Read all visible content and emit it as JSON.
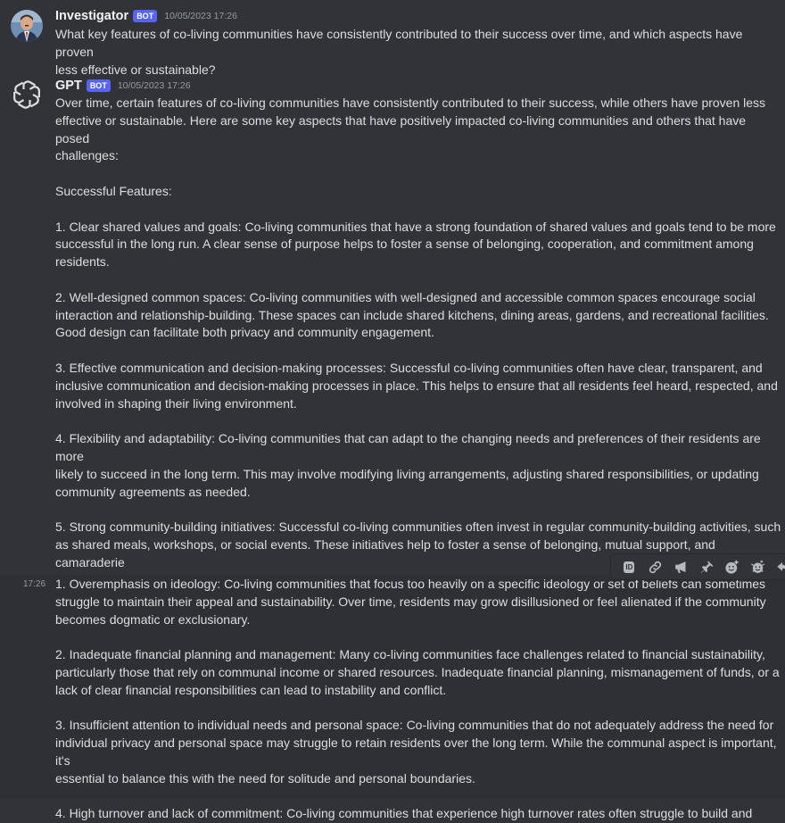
{
  "messages": [
    {
      "author": "Investigator",
      "badge": "BOT",
      "timestamp": "10/05/2023 17:26",
      "text": "What key features of co-living communities have consistently contributed to their success over time, and which aspects have proven\nless effective or sustainable?"
    },
    {
      "author": "GPT",
      "badge": "BOT",
      "timestamp": "10/05/2023 17:26",
      "text": "Over time, certain features of co-living communities have consistently contributed to their success, while others have proven less\neffective or sustainable. Here are some key aspects that have positively impacted co-living communities and others that have posed\nchallenges:\n\nSuccessful Features:\n\n1. Clear shared values and goals: Co-living communities that have a strong foundation of shared values and goals tend to be more\nsuccessful in the long run. A clear sense of purpose helps to foster a sense of belonging, cooperation, and commitment among\nresidents.\n\n2. Well-designed common spaces: Co-living communities with well-designed and accessible common spaces encourage social\ninteraction and relationship-building. These spaces can include shared kitchens, dining areas, gardens, and recreational facilities.\nGood design can facilitate both privacy and community engagement.\n\n3. Effective communication and decision-making processes: Successful co-living communities often have clear, transparent, and\ninclusive communication and decision-making processes in place. This helps to ensure that all residents feel heard, respected, and\ninvolved in shaping their living environment.\n\n4. Flexibility and adaptability: Co-living communities that can adapt to the changing needs and preferences of their residents are more\nlikely to succeed in the long term. This may involve modifying living arrangements, adjusting shared responsibilities, or updating\ncommunity agreements as needed.\n\n5. Strong community-building initiatives: Successful co-living communities often invest in regular community-building activities, such\nas shared meals, workshops, or social events. These initiatives help to foster a sense of belonging, mutual support, and camaraderie\namong residents.\n\nLess Effective or Sustainable Aspects:"
    },
    {
      "side_timestamp": "17:26",
      "text": "1. Overemphasis on ideology: Co-living communities that focus too heavily on a specific ideology or set of beliefs can sometimes\nstruggle to maintain their appeal and sustainability. Over time, residents may grow disillusioned or feel alienated if the community\nbecomes dogmatic or exclusionary.\n\n2. Inadequate financial planning and management: Many co-living communities face challenges related to financial sustainability,\nparticularly those that rely on communal income or shared resources. Inadequate financial planning, mismanagement of funds, or a\nlack of clear financial responsibilities can lead to instability and conflict.\n\n3. Insufficient attention to individual needs and personal space: Co-living communities that do not adequately address the need for\nindividual privacy and personal space may struggle to retain residents over the long term. While the communal aspect is important, it's\nessential to balance this with the need for solitude and personal boundaries.\n\n4. High turnover and lack of commitment: Co-living communities that experience high turnover rates often struggle to build and"
    }
  ],
  "toolbar": {
    "id_label": "ID",
    "icons": [
      "id-icon",
      "link-icon",
      "megaphone-icon",
      "pin-icon",
      "add-reaction-icon",
      "super-reaction-icon",
      "reply-icon"
    ]
  }
}
